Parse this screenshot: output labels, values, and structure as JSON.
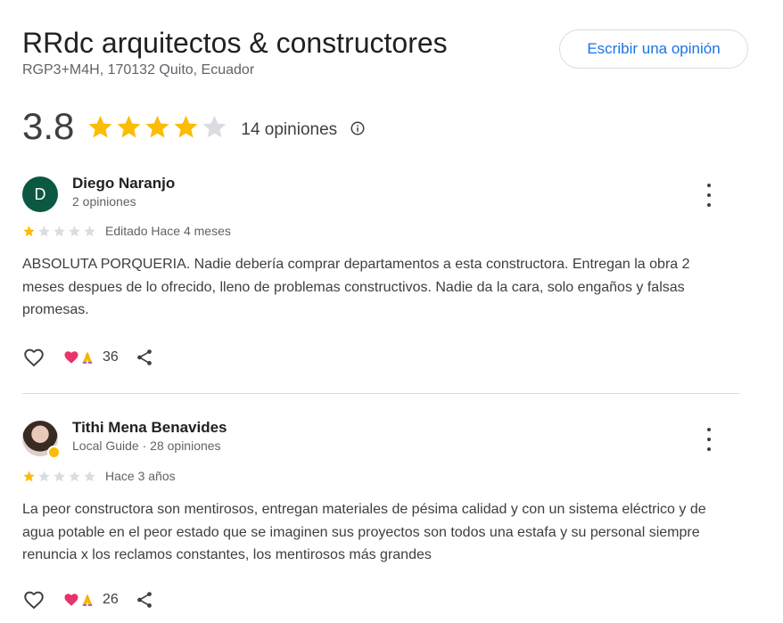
{
  "place": {
    "name": "RRdc arquitectos & constructores",
    "address": "RGP3+M4H, 170132 Quito, Ecuador",
    "write_review_label": "Escribir una opinión",
    "rating": "3.8",
    "rating_value": 3.8,
    "review_count_label": "14 opiniones"
  },
  "colors": {
    "star": "#fbbc04",
    "star_empty": "#dadce0",
    "accent": "#1a73e8"
  },
  "icons": [
    "star-icon",
    "info-icon",
    "more-vert-icon",
    "heart-outline-icon",
    "heart-reaction-icon",
    "pray-reaction-icon",
    "share-icon"
  ],
  "reviews": [
    {
      "avatar_letter": "D",
      "author": "Diego Naranjo",
      "meta": "2 opiniones",
      "stars": 1,
      "date": "Editado Hace 4 meses",
      "text": "ABSOLUTA PORQUERIA. Nadie debería comprar departamentos a esta constructora. Entregan la obra 2 meses despues de lo ofrecido, lleno de problemas constructivos. Nadie da la cara, solo engaños y falsas promesas.",
      "reactions": "36"
    },
    {
      "avatar_letter": "",
      "author": "Tithi Mena Benavides",
      "meta": "Local Guide · 28 opiniones",
      "stars": 1,
      "date": "Hace 3 años",
      "text": "La peor constructora son mentirosos, entregan materiales de pésima calidad y con un sistema eléctrico y de agua potable en el peor estado que se imaginen sus proyectos son todos una estafa y su personal siempre renuncia x los reclamos constantes, los mentirosos más grandes",
      "reactions": "26"
    }
  ]
}
